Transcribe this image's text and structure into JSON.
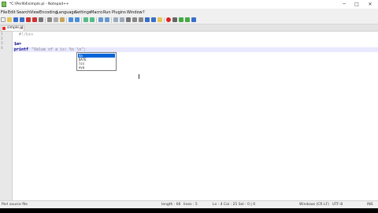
{
  "window": {
    "title": "*C:\\Perl64\\simple.pl - Notepad++",
    "minimize": "─",
    "maximize": "□",
    "close": "✕"
  },
  "menu": [
    "File",
    "Edit",
    "Search",
    "View",
    "Encoding",
    "Language",
    "Settings",
    "Macro",
    "Run",
    "Plugins",
    "Window",
    "?"
  ],
  "tab": {
    "label": "simple.pl",
    "close": "x",
    "icon": "red-file-icon"
  },
  "editor": {
    "line_numbers": [
      "1",
      "2",
      "3",
      "4"
    ],
    "line1": "  #!/bin",
    "line3_kw": "$a=",
    "line4_kw": "printf",
    "line4_str": "\"Value of a is: %s \\n\";",
    "autocomplete": [
      "$a",
      "DATE",
      "lcs",
      "eva"
    ]
  },
  "status": {
    "file_type": "Perl source file",
    "length": "length : 66",
    "lines": "lines : 5",
    "position": "Ln : 4   Col : 25   Sel : 0 | 0",
    "eol": "Windows (CR LF)",
    "encoding": "UTF-8",
    "mode": "INS"
  },
  "colors": {
    "selection": "#0a64d8",
    "keyword": "#000080",
    "string": "#808080"
  }
}
